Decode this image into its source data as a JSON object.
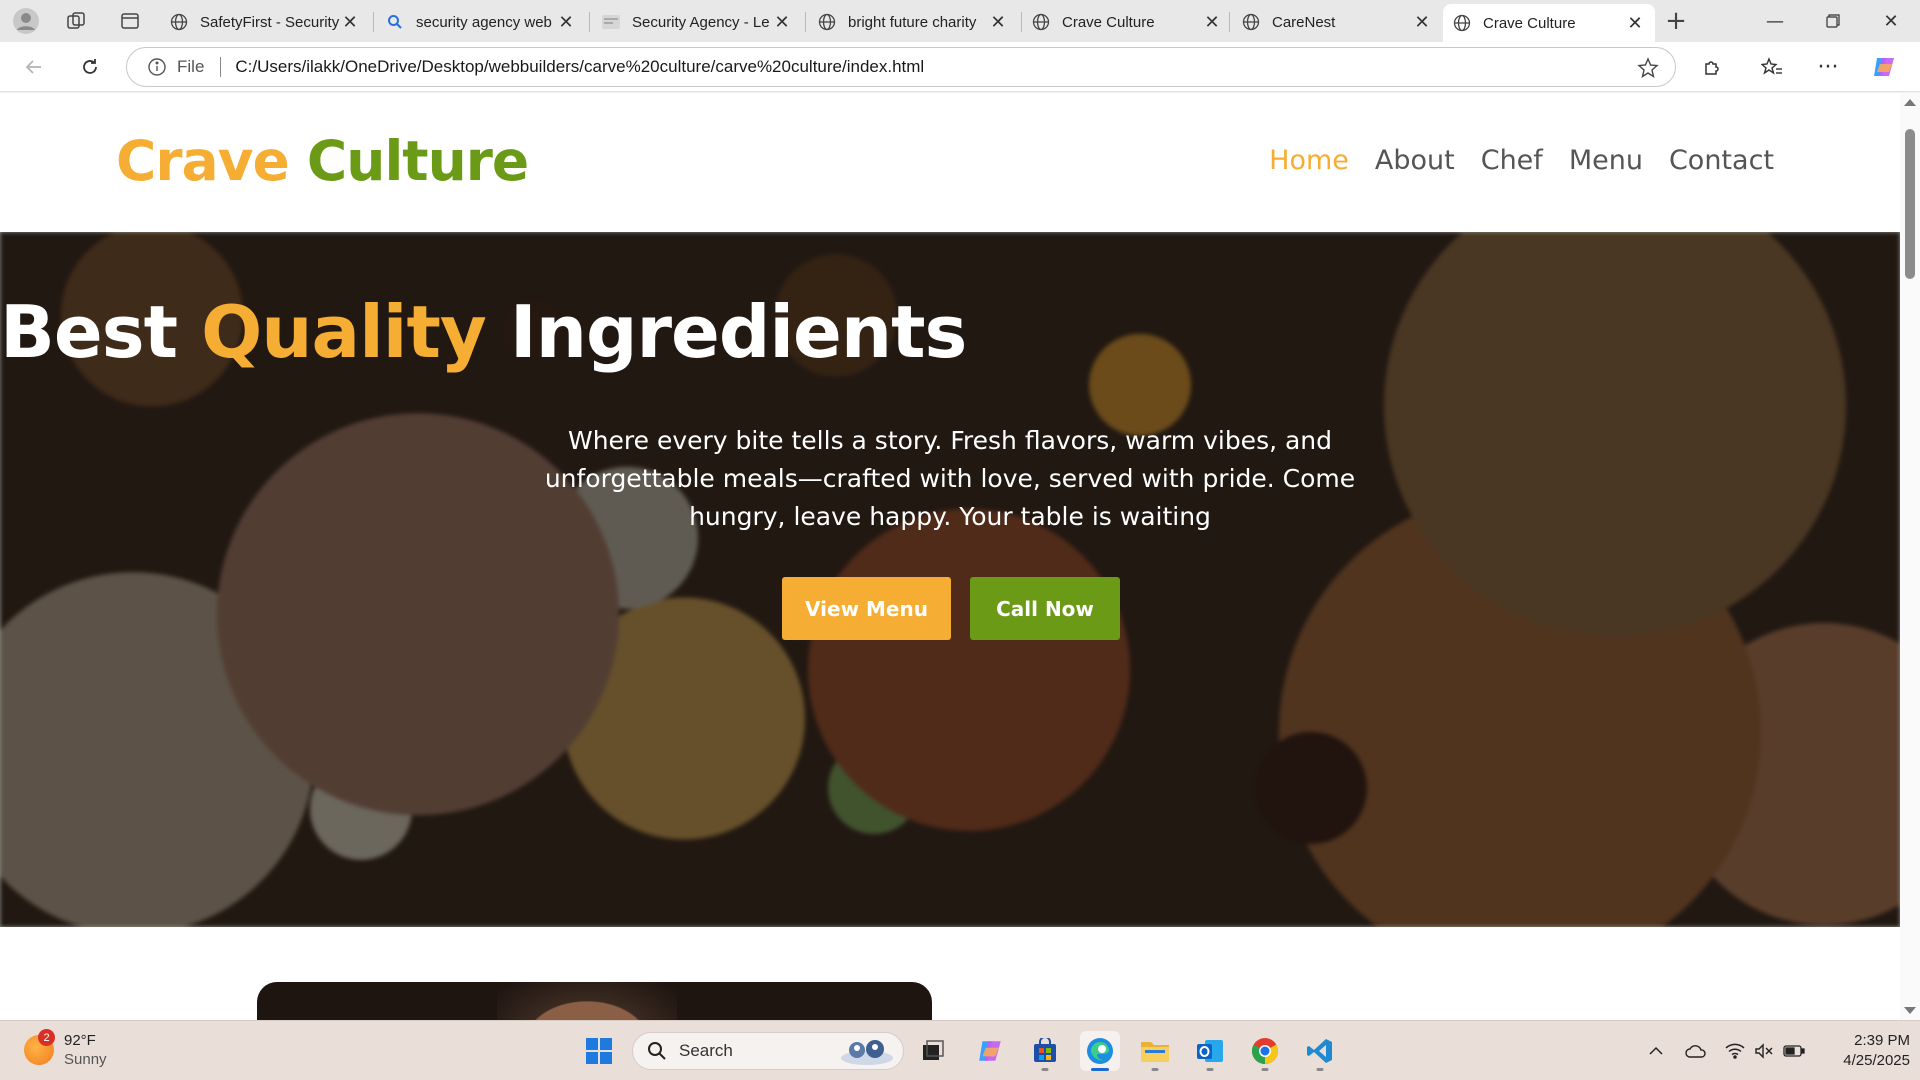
{
  "browser": {
    "tabs": [
      {
        "title": "SafetyFirst - Security",
        "favicon": "globe-icon"
      },
      {
        "title": "security agency web",
        "favicon": "search-icon"
      },
      {
        "title": "Security Agency - Le",
        "favicon": "page-thumbnail-icon"
      },
      {
        "title": "bright future charity",
        "favicon": "globe-icon"
      },
      {
        "title": "Crave Culture",
        "favicon": "globe-icon"
      },
      {
        "title": "CareNest",
        "favicon": "globe-icon"
      },
      {
        "title": "Crave Culture",
        "favicon": "globe-icon",
        "active": true
      }
    ],
    "address": {
      "scheme_label": "File",
      "url": "C:/Users/ilakk/OneDrive/Desktop/webbuilders/carve%20culture/carve%20culture/index.html"
    }
  },
  "site": {
    "logo": {
      "part1": "Crave",
      "part2": "Culture"
    },
    "nav": [
      "Home",
      "About",
      "Chef",
      "Menu",
      "Contact"
    ],
    "nav_current": "Home",
    "hero": {
      "title_part1": "Best",
      "title_highlight": "Quality",
      "title_part2": "Ingredients",
      "subtitle": "Where every bite tells a story. Fresh flavors, warm vibes, and unforgettable meals—crafted with love, served with pride. Come hungry, leave happy. Your table is waiting",
      "primary_button": "View Menu",
      "secondary_button": "Call Now"
    },
    "colors": {
      "accent_orange": "#f6ad33",
      "accent_green": "#6b9a16"
    }
  },
  "taskbar": {
    "weather": {
      "temp": "92°F",
      "condition": "Sunny",
      "badge": "2"
    },
    "search_label": "Search",
    "clock": {
      "time": "2:39 PM",
      "date": "4/25/2025"
    }
  }
}
